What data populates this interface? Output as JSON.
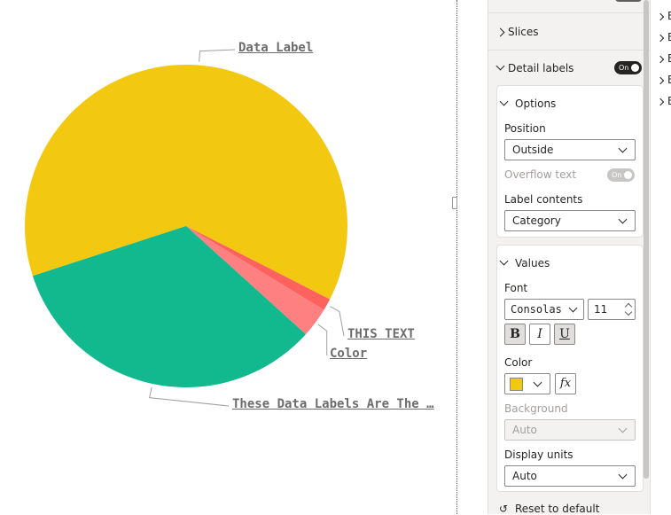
{
  "chart_data": {
    "type": "pie",
    "slices": [
      {
        "label": "Data Label",
        "value": 62.5,
        "color": "#F2C811"
      },
      {
        "label": "THIS TEXT",
        "value": 1.2,
        "color": "#FD625E"
      },
      {
        "label": "Color",
        "value": 3.0,
        "color": "#FF8080"
      },
      {
        "label": "These Data Labels Are The …",
        "value": 33.3,
        "color": "#12B88E"
      }
    ],
    "legend": "none",
    "label_style": {
      "font": "Consolas",
      "size": 11,
      "bold": true,
      "underline": true
    }
  },
  "format_pane": {
    "sections": {
      "slices": "Slices",
      "detail_labels": "Detail labels"
    },
    "detail_labels_toggle": "On",
    "options": {
      "title": "Options",
      "position_label": "Position",
      "position_value": "Outside",
      "overflow_label": "Overflow text",
      "overflow_toggle": "On",
      "label_contents_label": "Label contents",
      "label_contents_value": "Category"
    },
    "values": {
      "title": "Values",
      "font_label": "Font",
      "font_value": "Consolas",
      "font_size": "11",
      "bold": "B",
      "italic": "I",
      "underline": "U",
      "color_label": "Color",
      "color_value": "#F2C811",
      "fx": "fx",
      "background_label": "Background",
      "background_value": "Auto",
      "display_units_label": "Display units",
      "display_units_value": "Auto"
    },
    "reset": "Reset to default"
  },
  "fields": [
    "E",
    "E",
    "E",
    "E",
    "E"
  ]
}
